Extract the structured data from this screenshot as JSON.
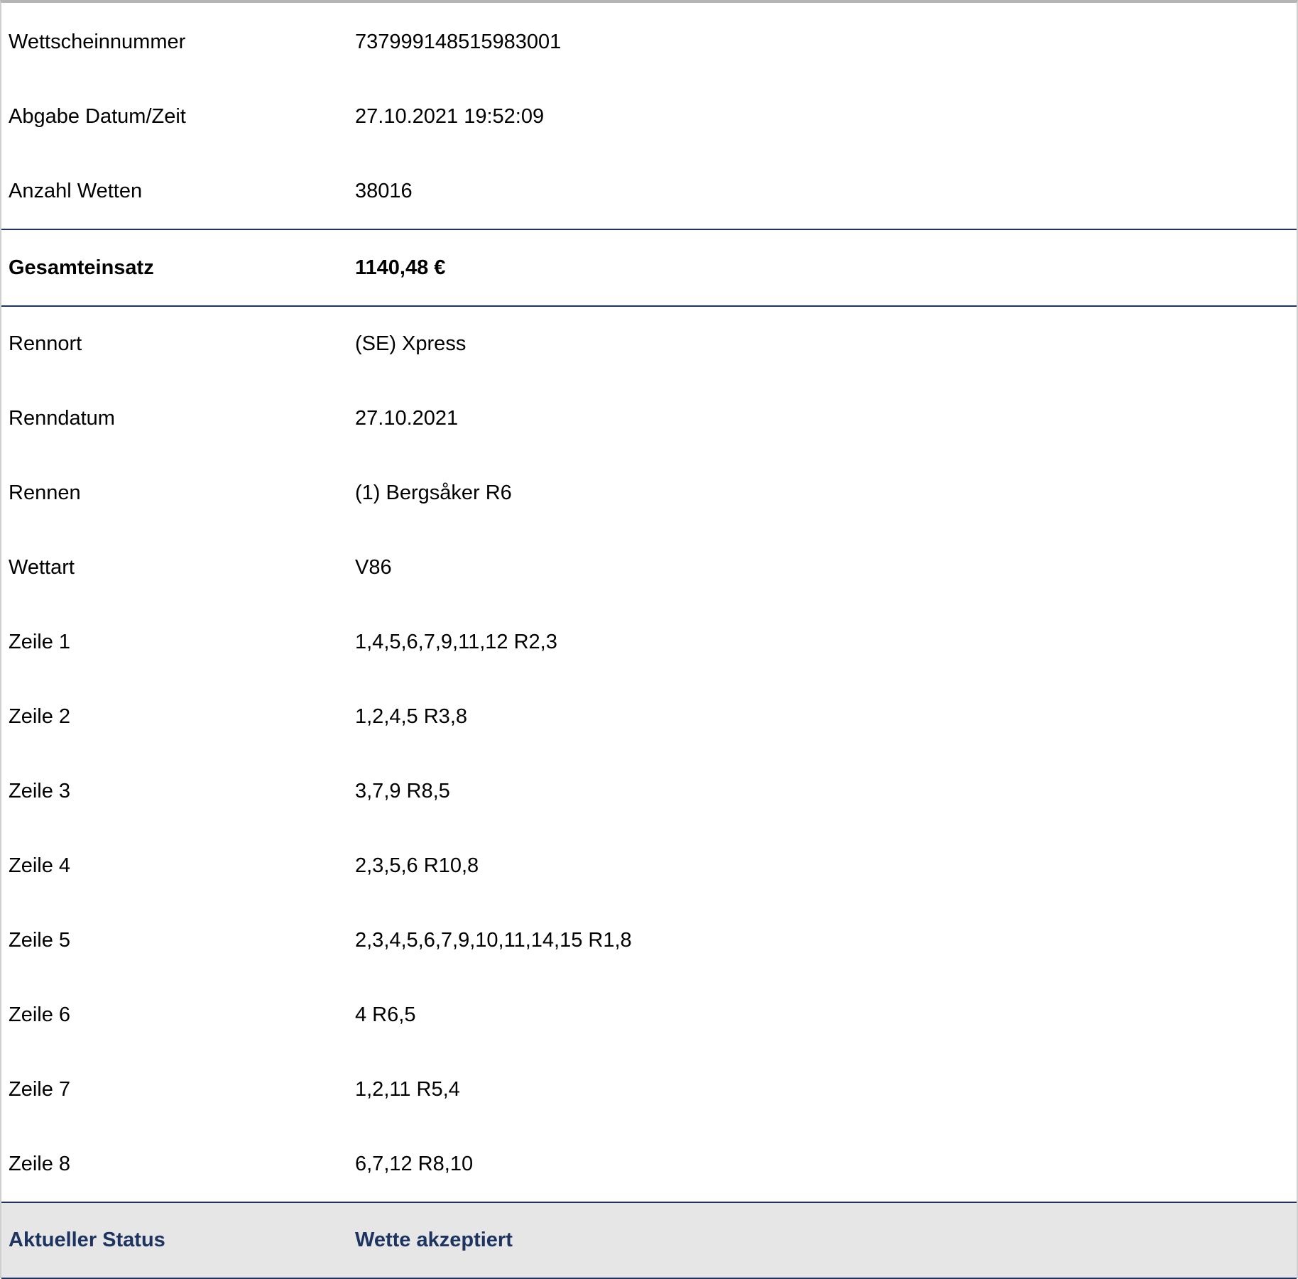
{
  "ticket": {
    "header_rows": [
      {
        "label": "Wettscheinnummer",
        "value": "737999148515983001"
      },
      {
        "label": "Abgabe Datum/Zeit",
        "value": "27.10.2021 19:52:09"
      },
      {
        "label": "Anzahl Wetten",
        "value": "38016"
      }
    ],
    "total": {
      "label": "Gesamteinsatz",
      "value": "1140,48 €"
    },
    "detail_rows": [
      {
        "label": "Rennort",
        "value": "(SE) Xpress"
      },
      {
        "label": "Renndatum",
        "value": "27.10.2021"
      },
      {
        "label": "Rennen",
        "value": "(1) Bergsåker R6"
      },
      {
        "label": "Wettart",
        "value": "V86"
      },
      {
        "label": "Zeile 1",
        "value": "1,4,5,6,7,9,11,12 R2,3"
      },
      {
        "label": "Zeile 2",
        "value": "1,2,4,5 R3,8"
      },
      {
        "label": "Zeile 3",
        "value": "3,7,9 R8,5"
      },
      {
        "label": "Zeile 4",
        "value": "2,3,5,6 R10,8"
      },
      {
        "label": "Zeile 5",
        "value": "2,3,4,5,6,7,9,10,11,14,15 R1,8"
      },
      {
        "label": "Zeile 6",
        "value": "4 R6,5"
      },
      {
        "label": "Zeile 7",
        "value": "1,2,11 R5,4"
      },
      {
        "label": "Zeile 8",
        "value": "6,7,12 R8,10"
      }
    ],
    "status": {
      "label": "Aktueller Status",
      "value": "Wette akzeptiert"
    }
  },
  "colors": {
    "status_text": "#1d3461",
    "status_background": "#e6e6e6",
    "divider": "#1d3461"
  }
}
